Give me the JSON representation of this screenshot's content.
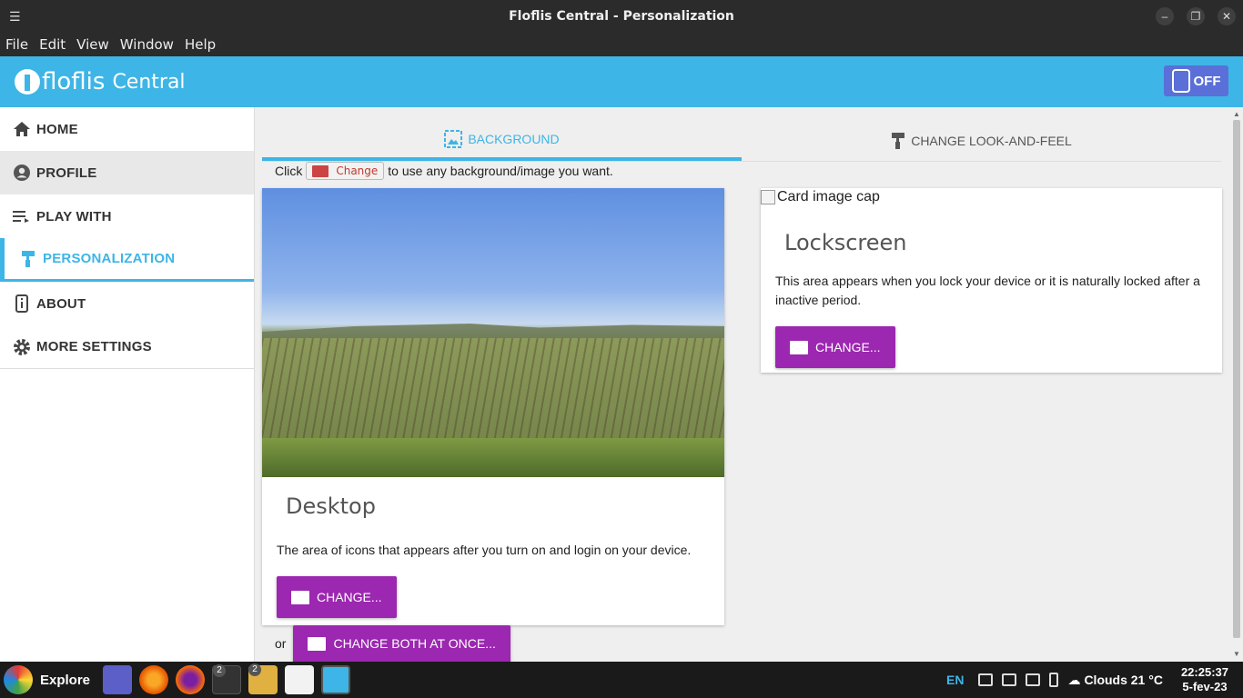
{
  "window": {
    "title": "Floflis Central - Personalization",
    "minimize": "–",
    "maximize": "❐",
    "close": "✕"
  },
  "menubar": [
    "File",
    "Edit",
    "View",
    "Window",
    "Help"
  ],
  "header": {
    "brand_part1": "floflis",
    "brand_part2": "Central",
    "power_label": "OFF"
  },
  "sidebar": {
    "items": [
      {
        "label": "HOME",
        "icon": "home-icon"
      },
      {
        "label": "PROFILE",
        "icon": "account-circle-icon"
      },
      {
        "label": "PLAY WITH",
        "icon": "playlist-icon"
      },
      {
        "label": "PERSONALIZATION",
        "icon": "paint-roller-icon"
      },
      {
        "label": "ABOUT",
        "icon": "info-icon"
      },
      {
        "label": "MORE SETTINGS",
        "icon": "gear-icon"
      }
    ]
  },
  "tabs": [
    {
      "label": "BACKGROUND",
      "icon": "image-icon",
      "active": true
    },
    {
      "label": "CHANGE LOOK-AND-FEEL",
      "icon": "paint-roller-icon",
      "active": false
    }
  ],
  "hint": {
    "before": "Click",
    "chip_label": "Change",
    "after": "to use any background/image you want."
  },
  "desktop_card": {
    "title": "Desktop",
    "text": "The area of icons that appears after you turn on and login on your device.",
    "button": "CHANGE..."
  },
  "lock_card": {
    "image_alt": "Card image cap",
    "title": "Lockscreen",
    "text": "This area appears when you lock your device or it is naturally locked after a inactive period.",
    "button": "CHANGE..."
  },
  "both": {
    "or": "or",
    "button": "CHANGE BOTH AT ONCE..."
  },
  "taskbar": {
    "start_label": "Explore",
    "apps": [
      {
        "name": "teams",
        "badge": ""
      },
      {
        "name": "orb",
        "badge": ""
      },
      {
        "name": "firefox",
        "badge": ""
      },
      {
        "name": "terminal",
        "badge": "2"
      },
      {
        "name": "files",
        "badge": "2"
      },
      {
        "name": "text-editor",
        "badge": ""
      },
      {
        "name": "floflis-central",
        "badge": ""
      }
    ],
    "lang": "EN",
    "weather": "Clouds 21 °C",
    "time": "22:25:37",
    "date": "5-fev-23"
  },
  "colors": {
    "accent": "#3db5e6",
    "purple": "#9c27b0",
    "power": "#5a6fd8"
  }
}
